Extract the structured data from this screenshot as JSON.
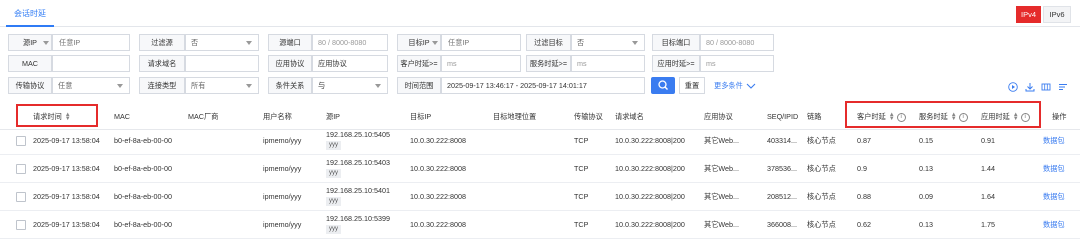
{
  "tabs": [
    {
      "label": "会话时延"
    }
  ],
  "filters": {
    "src_ip": {
      "label": "源IP",
      "placeholder": "任意IP"
    },
    "filter_src": {
      "label": "过滤源",
      "value": "否"
    },
    "src_port": {
      "label": "源端口",
      "value": "80 / 8000-8080"
    },
    "dst_ip": {
      "label": "目标IP",
      "placeholder": "任意IP"
    },
    "filter_dst": {
      "label": "过滤目标",
      "value": "否"
    },
    "dst_port": {
      "label": "目标端口",
      "value": "80 / 8000-8080"
    },
    "mac": {
      "label": "MAC"
    },
    "req_domain": {
      "label": "请求域名"
    },
    "app_protocol": {
      "label": "应用协议",
      "value": "应用协议"
    },
    "client_delay": {
      "label": "客户时延>=",
      "value": "ms"
    },
    "server_delay": {
      "label": "服务时延>=",
      "value": "ms"
    },
    "app_delay": {
      "label": "应用时延>=",
      "value": "ms"
    },
    "transport": {
      "label": "传输协议",
      "value": "任意"
    },
    "conn_type": {
      "label": "连接类型",
      "value": "所有"
    },
    "cond_relation": {
      "label": "条件关系",
      "value": "与"
    },
    "time_range": {
      "label": "时间范围",
      "value": "2025-09-17 13:46:17 - 2025-09-17 14:01:17"
    },
    "reset_label": "重置",
    "more_label": "更多条件"
  },
  "ip_toggle": {
    "ipv4": "IPv4",
    "ipv6": "IPv6",
    "active": "IPv4"
  },
  "columns": {
    "req_time": "请求时间",
    "mac": "MAC",
    "mac_vendor": "MAC厂商",
    "username": "用户名称",
    "src_ip": "源IP",
    "dst_ip": "目标IP",
    "dst_geo": "目标地理位置",
    "transport": "传输协议",
    "req_domain": "请求域名",
    "app_protocol": "应用协议",
    "seq": "SEQ/IPID",
    "link": "链路",
    "client_delay": "客户时延",
    "server_delay": "服务时延",
    "app_delay": "应用时延",
    "action": "操作"
  },
  "rows": [
    {
      "time": "2025-09-17 13:58:04",
      "mac": "b0-ef-8a-eb-00-00",
      "user": "ipmemo/yyy",
      "src_ip": "192.168.25.10:5405",
      "src_tag": "yyy",
      "dst_ip": "10.0.30.222:8008",
      "transport": "TCP",
      "domain": "10.0.30.222:8008|200",
      "app": "其它Web...",
      "seq": "403314...",
      "link": "核心节点",
      "client": "0.87",
      "server": "0.15",
      "appd": "0.91",
      "action": "数据包"
    },
    {
      "time": "2025-09-17 13:58:04",
      "mac": "b0-ef-8a-eb-00-00",
      "user": "ipmemo/yyy",
      "src_ip": "192.168.25.10:5403",
      "src_tag": "yyy",
      "dst_ip": "10.0.30.222:8008",
      "transport": "TCP",
      "domain": "10.0.30.222:8008|200",
      "app": "其它Web...",
      "seq": "378536...",
      "link": "核心节点",
      "client": "0.9",
      "server": "0.13",
      "appd": "1.44",
      "action": "数据包"
    },
    {
      "time": "2025-09-17 13:58:04",
      "mac": "b0-ef-8a-eb-00-00",
      "user": "ipmemo/yyy",
      "src_ip": "192.168.25.10:5401",
      "src_tag": "yyy",
      "dst_ip": "10.0.30.222:8008",
      "transport": "TCP",
      "domain": "10.0.30.222:8008|200",
      "app": "其它Web...",
      "seq": "208512...",
      "link": "核心节点",
      "client": "0.88",
      "server": "0.09",
      "appd": "1.64",
      "action": "数据包"
    },
    {
      "time": "2025-09-17 13:58:04",
      "mac": "b0-ef-8a-eb-00-00",
      "user": "ipmemo/yyy",
      "src_ip": "192.168.25.10:5399",
      "src_tag": "yyy",
      "dst_ip": "10.0.30.222:8008",
      "transport": "TCP",
      "domain": "10.0.30.222:8008|200",
      "app": "其它Web...",
      "seq": "366008...",
      "link": "核心节点",
      "client": "0.62",
      "server": "0.13",
      "appd": "1.75",
      "action": "数据包"
    }
  ],
  "colors": {
    "accent": "#3a7cf0",
    "highlight": "#e52b2b",
    "ipv4_active": "#e52b2b"
  },
  "icons": [
    "search-icon",
    "play-icon",
    "download-icon",
    "columns-icon",
    "settings-icon",
    "sort-icon",
    "info-icon",
    "chevron-down-icon"
  ]
}
